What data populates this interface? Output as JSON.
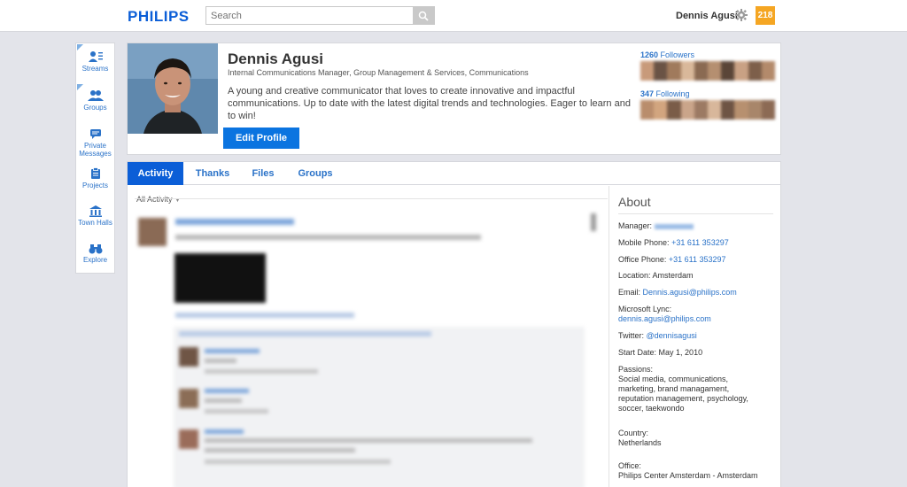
{
  "header": {
    "logo": "PHILIPS",
    "search_placeholder": "Search",
    "user_name": "Dennis Agusi",
    "notification_count": "218"
  },
  "nav": {
    "items": [
      {
        "label": "Streams",
        "icon": "streams-icon"
      },
      {
        "label": "Groups",
        "icon": "groups-icon"
      },
      {
        "label": "Private Messages",
        "icon": "messages-icon"
      },
      {
        "label": "Projects",
        "icon": "projects-icon"
      },
      {
        "label": "Town Halls",
        "icon": "town-halls-icon"
      },
      {
        "label": "Explore",
        "icon": "explore-icon"
      }
    ]
  },
  "profile": {
    "name": "Dennis Agusi",
    "title": "Internal Communications Manager, Group Management & Services, Communications",
    "bio": "A young and creative communicator that loves to create innovative and impactful communications. Up to date with the latest digital trends and technologies. Eager to learn and to win!",
    "edit_label": "Edit Profile",
    "followers_count": "1260",
    "followers_label": "Followers",
    "following_count": "347",
    "following_label": "Following"
  },
  "tabs": [
    {
      "label": "Activity",
      "active": true
    },
    {
      "label": "Thanks",
      "active": false
    },
    {
      "label": "Files",
      "active": false
    },
    {
      "label": "Groups",
      "active": false
    }
  ],
  "activity": {
    "filter_label": "All Activity"
  },
  "about": {
    "heading": "About",
    "manager_label": "Manager:",
    "mobile_label": "Mobile Phone:",
    "mobile_value": "+31 611 353297",
    "office_label": "Office Phone:",
    "office_value": "+31 611 353297",
    "location_label": "Location:",
    "location_value": "Amsterdam",
    "email_label": "Email:",
    "email_value": "Dennis.agusi@philips.com",
    "lync_label": "Microsoft Lync:",
    "lync_value": "dennis.agusi@philips.com",
    "twitter_label": "Twitter:",
    "twitter_value": "@dennisagusi",
    "start_label": "Start Date:",
    "start_value": "May 1, 2010",
    "passions_label": "Passions:",
    "passions_value": "Social media, communications, marketing, brand managament, reputation management, psychology, soccer, taekwondo",
    "country_label": "Country:",
    "country_value": "Netherlands",
    "officeloc_label": "Office:",
    "officeloc_value": "Philips Center Amsterdam - Amsterdam"
  },
  "colors": {
    "brand_blue": "#0b5ed7",
    "link_blue": "#2a72c8",
    "badge_orange": "#f5a623",
    "page_bg": "#e3e4ea"
  }
}
